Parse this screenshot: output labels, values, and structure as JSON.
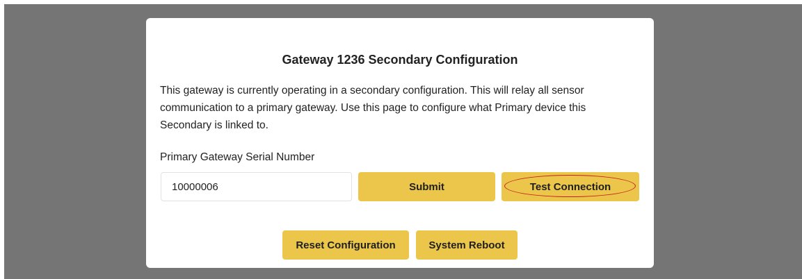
{
  "modal": {
    "title": "Gateway 1236 Secondary Configuration",
    "description": "This gateway is currently operating in a secondary configuration. This will relay all sensor communication to a primary gateway. Use this page to configure what Primary device this Secondary is linked to."
  },
  "form": {
    "serial_label": "Primary Gateway Serial Number",
    "serial_value": "10000006",
    "submit_label": "Submit",
    "test_connection_label": "Test Connection"
  },
  "actions": {
    "reset_label": "Reset Configuration",
    "reboot_label": "System Reboot"
  },
  "colors": {
    "backdrop": "#757575",
    "button": "#ecc64a",
    "highlight": "#c42020"
  }
}
